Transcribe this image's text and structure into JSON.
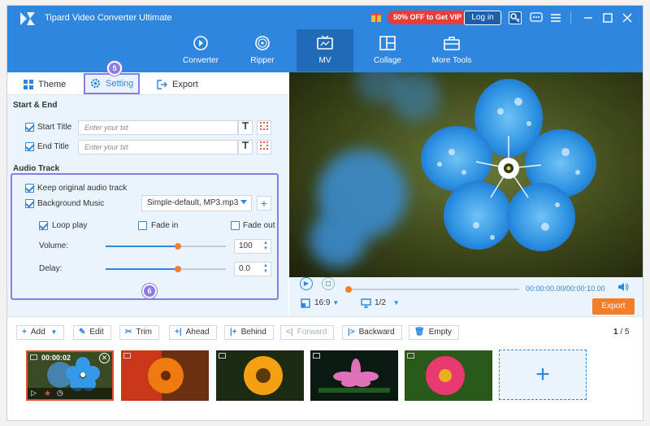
{
  "app": {
    "title": "Tipard Video Converter Ultimate"
  },
  "header": {
    "promo": "50% OFF to Get VIP",
    "login": "Log in"
  },
  "nav": [
    {
      "label": "Converter",
      "icon": "converter-icon"
    },
    {
      "label": "Ripper",
      "icon": "ripper-icon"
    },
    {
      "label": "MV",
      "icon": "mv-icon",
      "active": true
    },
    {
      "label": "Collage",
      "icon": "collage-icon"
    },
    {
      "label": "More Tools",
      "icon": "toolbox-icon"
    }
  ],
  "tabs": {
    "theme": "Theme",
    "setting": "Setting",
    "export": "Export"
  },
  "callouts": {
    "setting": "5",
    "audio": "6"
  },
  "start_end": {
    "title": "Start & End",
    "start_label": "Start Title",
    "end_label": "End Title",
    "placeholder": "Enter your txt"
  },
  "audio": {
    "title": "Audio Track",
    "keep_original": "Keep original audio track",
    "background_music": "Background Music",
    "music_file": "Simple-default, MP3.mp3",
    "loop_play": "Loop play",
    "fade_in": "Fade in",
    "fade_out": "Fade out",
    "volume_label": "Volume:",
    "volume_value": "100",
    "volume_level": 0.6,
    "delay_label": "Delay:",
    "delay_value": "0.0",
    "delay_level": 0.6
  },
  "player": {
    "time": "00:00:00.00/00:00:10.00",
    "aspect": "16:9",
    "quality": "1/2",
    "export": "Export"
  },
  "toolbar": {
    "add": "Add",
    "edit": "Edit",
    "trim": "Trim",
    "ahead": "Ahead",
    "behind": "Behind",
    "forward": "Forward",
    "backward": "Backward",
    "empty": "Empty",
    "page_current": "1",
    "page_sep": "/",
    "page_total": "5"
  },
  "timeline": {
    "first_duration": "00:00:02"
  },
  "colors": {
    "accent": "#2e86de",
    "orange": "#f37e2a",
    "callout": "#8c7ae6"
  }
}
